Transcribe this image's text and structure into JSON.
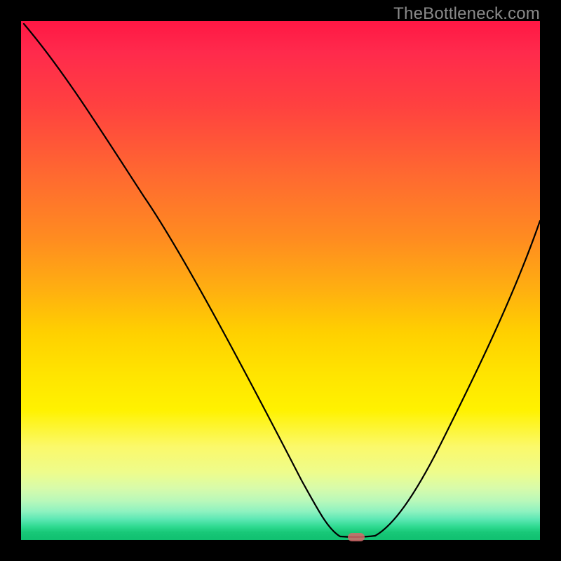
{
  "watermark": "TheBottleneck.com",
  "chart_data": {
    "type": "line",
    "title": "",
    "xlabel": "",
    "ylabel": "",
    "xlim": [
      0,
      100
    ],
    "ylim": [
      0,
      100
    ],
    "x": [
      0,
      8,
      18,
      28,
      38,
      48,
      55,
      58,
      61,
      64,
      68,
      72,
      76,
      82,
      88,
      94,
      100
    ],
    "y": [
      100,
      91,
      80,
      68,
      54,
      34,
      17,
      7,
      1.5,
      0.5,
      0.5,
      2,
      8,
      21,
      36,
      50,
      62
    ],
    "marker_x": 64.5,
    "marker_y": 0.5,
    "gradient_colors": {
      "top": "#ff1744",
      "mid": "#ffd000",
      "bottom": "#10c070"
    }
  }
}
